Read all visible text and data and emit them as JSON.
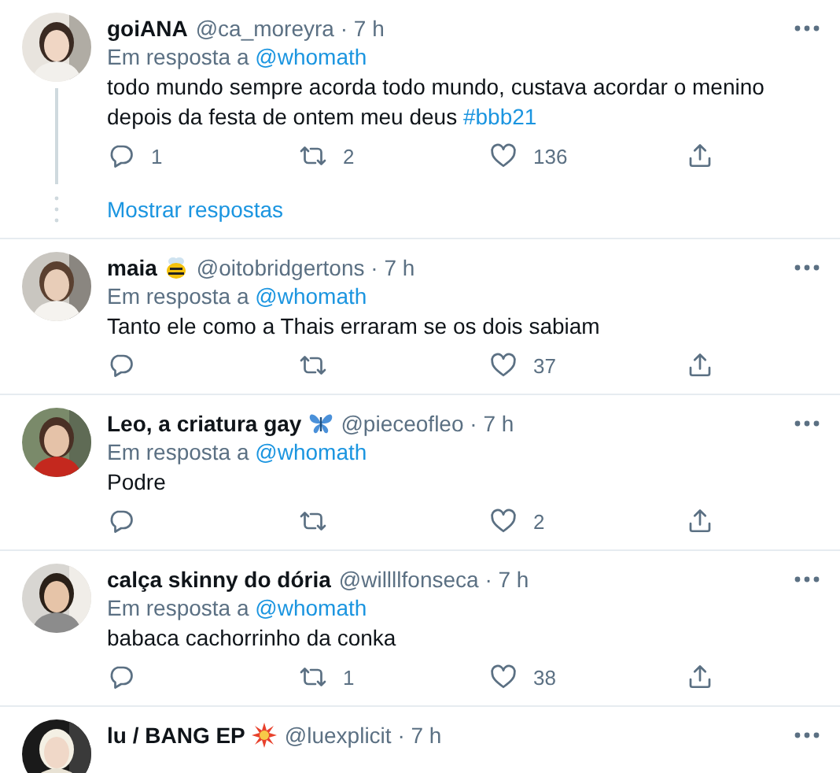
{
  "tweets": [
    {
      "display_name": "goiANA",
      "handle": "@ca_moreyra",
      "separator": "·",
      "time": "7 h",
      "reply_label": "Em resposta a",
      "reply_to": "@whomath",
      "text": "todo mundo sempre acorda todo mundo, custava acordar o menino depois da festa de ontem meu deus",
      "hashtag": "#bbb21",
      "replies": "1",
      "retweets": "2",
      "likes": "136",
      "show_replies": "Mostrar respostas"
    },
    {
      "display_name": "maia",
      "badge": {
        "kind": "bee"
      },
      "handle": "@oitobridgertons",
      "separator": "·",
      "time": "7 h",
      "reply_label": "Em resposta a",
      "reply_to": "@whomath",
      "text": "Tanto ele como a Thais erraram se os dois sabiam",
      "likes": "37"
    },
    {
      "display_name": "Leo, a criatura gay",
      "badge": {
        "kind": "butterfly"
      },
      "handle": "@pieceofleo",
      "separator": "·",
      "time": "7 h",
      "reply_label": "Em resposta a",
      "reply_to": "@whomath",
      "text": "Podre",
      "likes": "2"
    },
    {
      "display_name": "calça skinny do dória",
      "handle": "@willllfonseca",
      "separator": "·",
      "time": "7 h",
      "reply_label": "Em resposta a",
      "reply_to": "@whomath",
      "text": "babaca cachorrinho da conka",
      "retweets": "1",
      "likes": "38"
    },
    {
      "display_name": "lu / BANG EP",
      "badge": {
        "kind": "burst"
      },
      "handle": "@luexplicit",
      "separator": "·",
      "time": "7 h"
    }
  ]
}
